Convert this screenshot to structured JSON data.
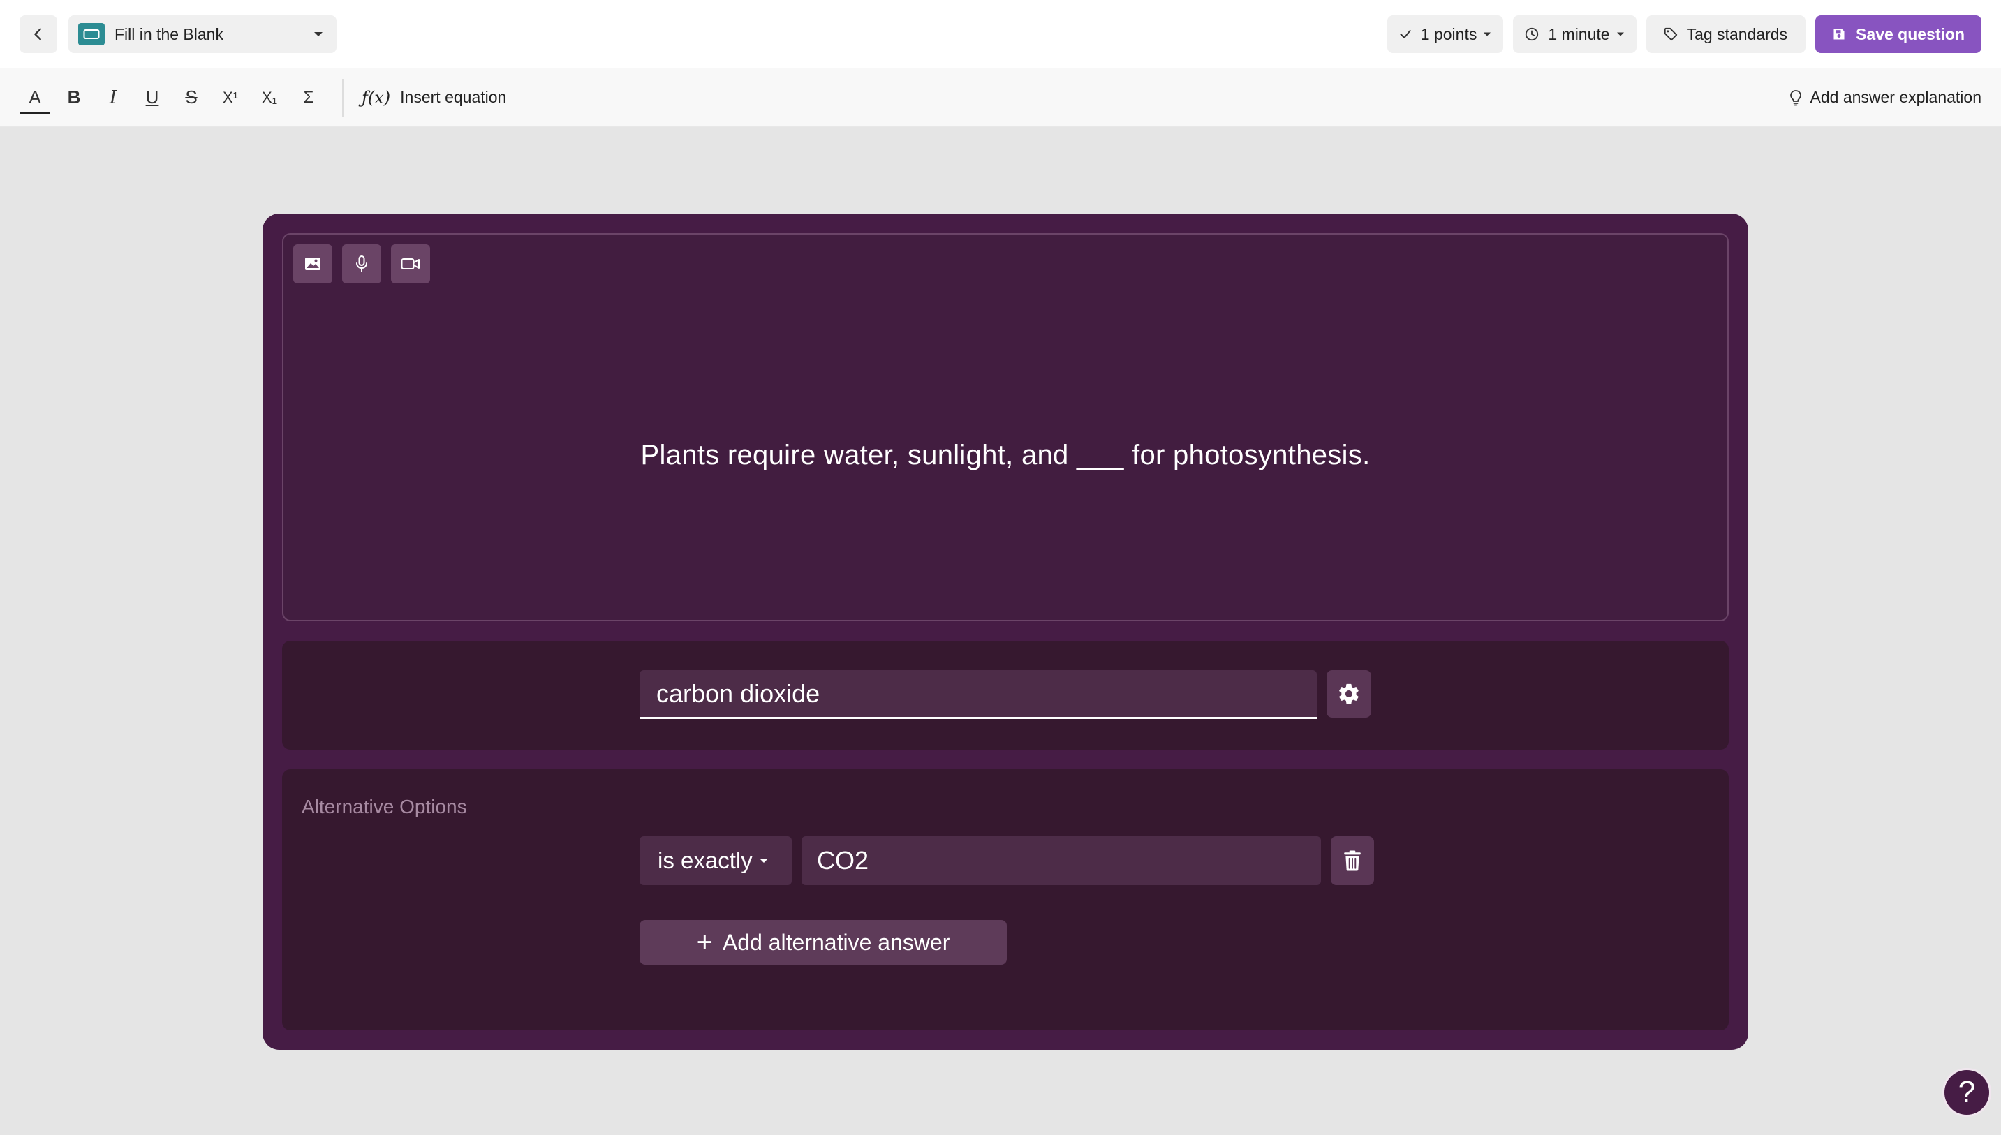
{
  "header": {
    "question_type": "Fill in the Blank",
    "points_label": "1 points",
    "time_label": "1 minute",
    "tag_standards_label": "Tag standards",
    "save_label": "Save question"
  },
  "toolbar": {
    "insert_equation_label": "Insert equation",
    "add_explanation_label": "Add answer explanation",
    "format_buttons": [
      "A",
      "B",
      "I",
      "U",
      "S",
      "X¹",
      "X₁",
      "Σ"
    ]
  },
  "question": {
    "text": "Plants require water, sunlight, and ___ for photosynthesis."
  },
  "answer": {
    "value": "carbon dioxide"
  },
  "alternatives": {
    "title": "Alternative Options",
    "items": [
      {
        "match_type": "is exactly",
        "value": "CO2"
      }
    ],
    "add_label": "Add alternative answer"
  },
  "help": {
    "label": "?"
  },
  "colors": {
    "accent": "#8854c0",
    "card_bg": "#461c45",
    "section_bg": "#36182f",
    "type_icon": "#2c8c93"
  }
}
